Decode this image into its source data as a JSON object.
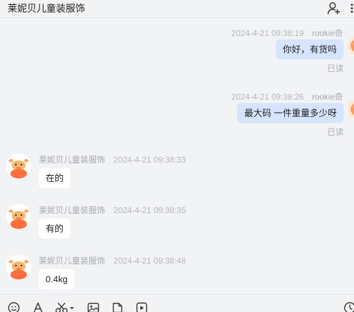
{
  "header": {
    "title": "莱妮贝儿童装服饰"
  },
  "messages": [
    {
      "direction": "out",
      "time": "2024-4-21 09:38:19",
      "sender": "rookie奇",
      "text": "你好，有货吗",
      "status": "已读"
    },
    {
      "direction": "out",
      "time": "2024-4-21 09:38:26",
      "sender": "rookie奇",
      "text": "最大码  一件重量多少呀",
      "status": "已读"
    },
    {
      "direction": "in",
      "sender": "莱妮贝儿童装服饰",
      "time": "2024-4-21 09:38:33",
      "text": "在的"
    },
    {
      "direction": "in",
      "sender": "莱妮贝儿童装服饰",
      "time": "2024-4-21 09:38:35",
      "text": "有的"
    },
    {
      "direction": "in",
      "sender": "莱妮贝儿童装服饰",
      "time": "2024-4-21 09:38:48",
      "text": "0.4kg"
    }
  ],
  "toolbar": {
    "icons": [
      "emoji-icon",
      "font-icon",
      "screenshot-icon",
      "image-icon",
      "file-icon",
      "video-icon",
      "history-icon"
    ]
  },
  "colors": {
    "background": "#f2f3f5",
    "outgoing_bubble": "#d6e4ff",
    "incoming_bubble": "#ffffff",
    "meta_text": "#b4b6bb",
    "avatar_accent": "#ff7a45"
  }
}
